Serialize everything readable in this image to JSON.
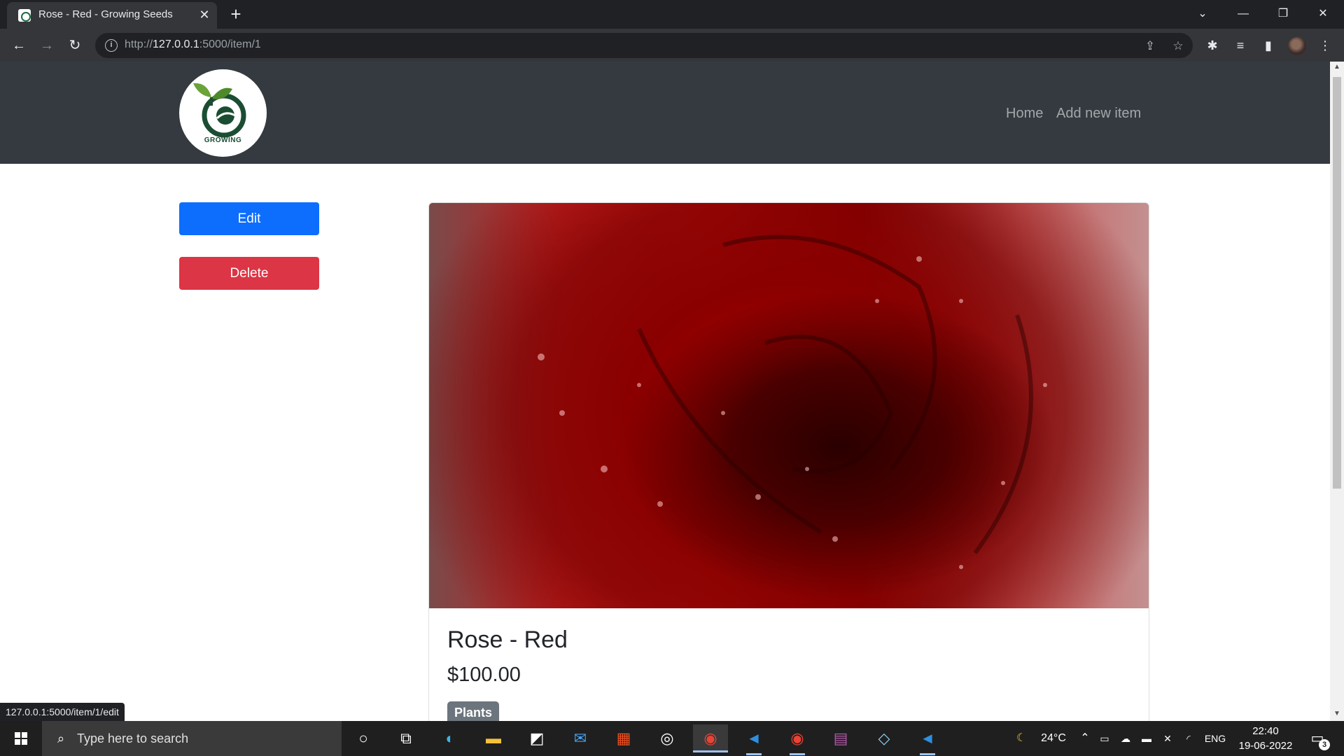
{
  "browser": {
    "tab_title": "Rose - Red - Growing Seeds",
    "tab_close": "✕",
    "new_tab": "+",
    "url_prefix": "http://",
    "url_host": "127.0.0.1",
    "url_path": ":5000/item/1",
    "status_link": "127.0.0.1:5000/item/1/edit",
    "icons": {
      "back": "←",
      "forward": "→",
      "reload": "↻",
      "info": "i",
      "share": "⇪",
      "star": "☆",
      "extensions": "✱",
      "media": "≡",
      "sidepanel": "▮",
      "menu": "⋮",
      "tab_search": "⌄",
      "minimize": "—",
      "restore": "❐",
      "close": "✕"
    }
  },
  "site": {
    "logo_text": "GROWING",
    "nav": [
      {
        "label": "Home"
      },
      {
        "label": "Add new item"
      }
    ]
  },
  "actions": {
    "edit_label": "Edit",
    "delete_label": "Delete"
  },
  "item": {
    "title": "Rose - Red",
    "price": "$100.00",
    "category": "Plants"
  },
  "taskbar": {
    "search_placeholder": "Type here to search",
    "temperature": "24°C",
    "language": "ENG",
    "time": "22:40",
    "date": "19-06-2022",
    "notification_count": "3",
    "apps": [
      {
        "name": "cortana",
        "glyph": "○"
      },
      {
        "name": "task-view",
        "glyph": "⧉"
      },
      {
        "name": "edge",
        "glyph": "◐"
      },
      {
        "name": "file-explorer",
        "glyph": "▬"
      },
      {
        "name": "whiteboard",
        "glyph": "◩"
      },
      {
        "name": "mail",
        "glyph": "✉"
      },
      {
        "name": "store",
        "glyph": "▦"
      },
      {
        "name": "obs",
        "glyph": "◎"
      },
      {
        "name": "chrome",
        "glyph": "◉"
      },
      {
        "name": "vscode",
        "glyph": "◄"
      },
      {
        "name": "chrome-profile",
        "glyph": "◉"
      },
      {
        "name": "winrar",
        "glyph": "▤"
      },
      {
        "name": "notes",
        "glyph": "◇"
      },
      {
        "name": "vscode-2",
        "glyph": "◄"
      }
    ]
  }
}
